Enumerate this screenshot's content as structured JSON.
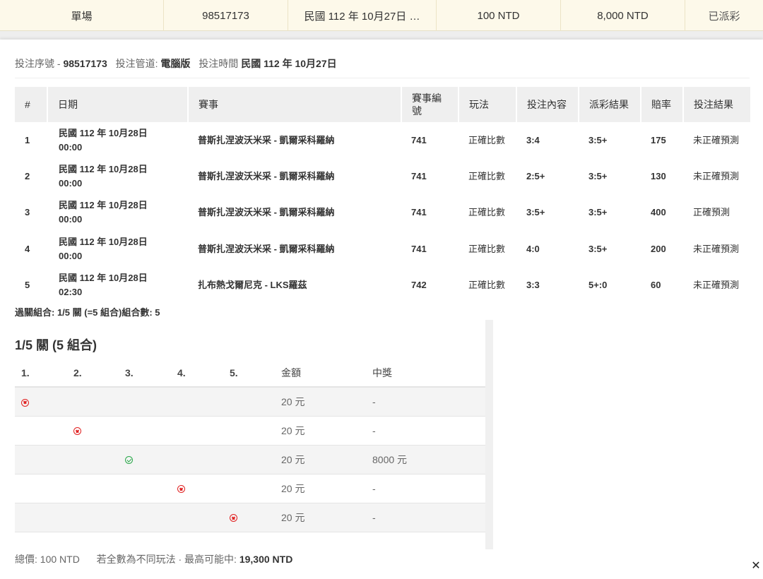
{
  "summary": {
    "type": "單場",
    "ticket_no": "98517173",
    "bet_time": "民國 112 年 10月27日 …",
    "stake": "100 NTD",
    "payout": "8,000 NTD",
    "status": "已派彩"
  },
  "bet_info": {
    "serial_label": "投注序號 -",
    "serial_value": "98517173",
    "channel_label": "投注管道:",
    "channel_value": "電腦版",
    "time_label": "投注時間",
    "time_value": "民國 112 年 10月27日"
  },
  "legs_table": {
    "headers": [
      "#",
      "日期",
      "賽事",
      "賽事編號",
      "玩法",
      "投注內容",
      "派彩結果",
      "賠率",
      "投注結果"
    ],
    "rows": [
      {
        "no": "1",
        "date": "民國 112 年 10月28日",
        "time": "00:00",
        "event": "普斯扎涅波沃米采 - 凱爾采科羅納",
        "event_no": "741",
        "play": "正確比數",
        "selection": "3:4",
        "result": "3:5+",
        "odds": "175",
        "outcome": "未正確預測"
      },
      {
        "no": "2",
        "date": "民國 112 年 10月28日",
        "time": "00:00",
        "event": "普斯扎涅波沃米采 - 凱爾采科羅納",
        "event_no": "741",
        "play": "正確比數",
        "selection": "2:5+",
        "result": "3:5+",
        "odds": "130",
        "outcome": "未正確預測"
      },
      {
        "no": "3",
        "date": "民國 112 年 10月28日",
        "time": "00:00",
        "event": "普斯扎涅波沃米采 - 凱爾采科羅納",
        "event_no": "741",
        "play": "正確比數",
        "selection": "3:5+",
        "result": "3:5+",
        "odds": "400",
        "outcome": "正確預測"
      },
      {
        "no": "4",
        "date": "民國 112 年 10月28日",
        "time": "00:00",
        "event": "普斯扎涅波沃米采 - 凱爾采科羅納",
        "event_no": "741",
        "play": "正確比數",
        "selection": "4:0",
        "result": "3:5+",
        "odds": "200",
        "outcome": "未正確預測"
      },
      {
        "no": "5",
        "date": "民國 112 年 10月28日",
        "time": "02:30",
        "event": "扎布熱戈爾尼克 - LKS羅茲",
        "event_no": "742",
        "play": "正確比數",
        "selection": "3:3",
        "result": "5+:0",
        "odds": "60",
        "outcome": "未正確預測"
      }
    ]
  },
  "combo_line": "過關組合: 1/5 關 (=5 組合)組合數: 5",
  "combo": {
    "title": "1/5 關 (5 組合)",
    "headers": [
      "1.",
      "2.",
      "3.",
      "4.",
      "5.",
      "金額",
      "中獎"
    ],
    "rows": [
      {
        "mark_col": 1,
        "mark": "lost",
        "amount": "20 元",
        "prize": "-"
      },
      {
        "mark_col": 2,
        "mark": "lost",
        "amount": "20 元",
        "prize": "-"
      },
      {
        "mark_col": 3,
        "mark": "won",
        "amount": "20 元",
        "prize": "8000 元"
      },
      {
        "mark_col": 4,
        "mark": "lost",
        "amount": "20 元",
        "prize": "-"
      },
      {
        "mark_col": 5,
        "mark": "lost",
        "amount": "20 元",
        "prize": "-"
      }
    ]
  },
  "footer": {
    "total_label": "總價:",
    "total_value": "100 NTD",
    "note": "若全數為不同玩法 · 最高可能中:",
    "max_value": "19,300 NTD"
  },
  "close_label": "✕"
}
